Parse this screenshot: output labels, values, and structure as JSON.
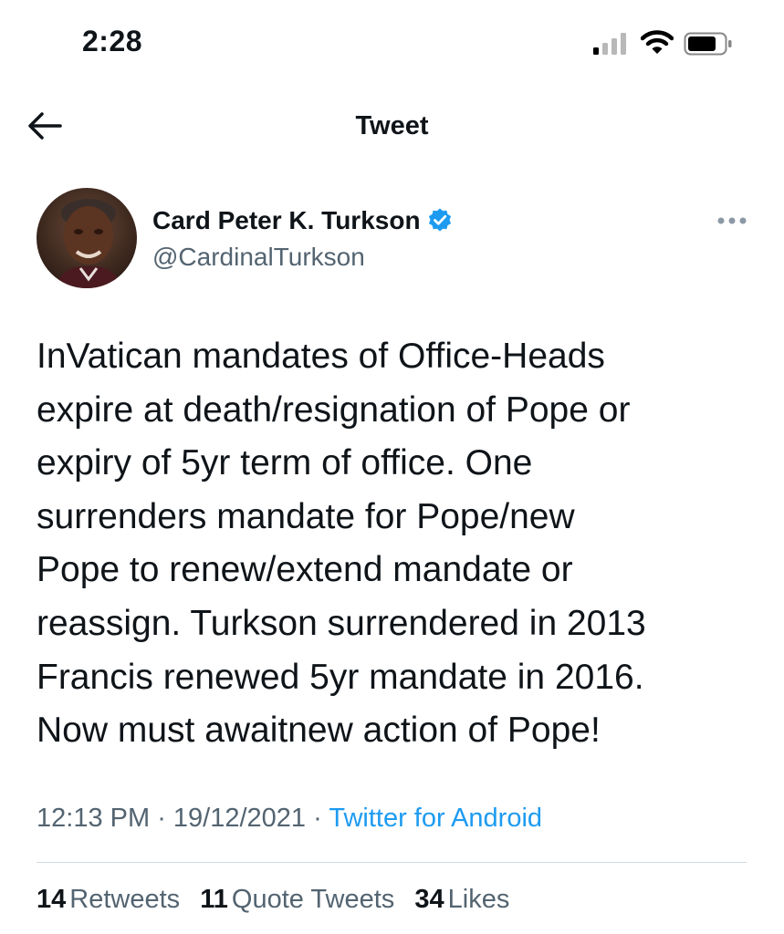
{
  "status_bar": {
    "time": "2:28",
    "signal_icon": "cellular-signal-icon",
    "wifi_icon": "wifi-icon",
    "battery_icon": "battery-icon"
  },
  "nav": {
    "title": "Tweet",
    "back_icon": "arrow-left-icon"
  },
  "author": {
    "name": "Card Peter K. Turkson",
    "handle": "@CardinalTurkson",
    "verified_icon": "verified-badge-icon",
    "more_icon": "more-options-icon"
  },
  "tweet": {
    "lines": [
      "InVatican mandates of Office-Heads",
      "expire at death/resignation of Pope or",
      "expiry of 5yr term of office. One",
      "surrenders mandate for Pope/new",
      "Pope to renew/extend mandate or",
      "reassign. Turkson surrendered in 2013",
      "Francis renewed 5yr mandate in 2016.",
      "Now must awaitnew action of Pope!"
    ]
  },
  "meta": {
    "time": "12:13 PM",
    "sep1": " · ",
    "date": "19/12/2021",
    "sep2": " · ",
    "source": "Twitter for Android"
  },
  "stats": {
    "retweets": {
      "count": "14",
      "label": "Retweets"
    },
    "quotes": {
      "count": "11",
      "label": "Quote Tweets"
    },
    "likes": {
      "count": "34",
      "label": "Likes"
    }
  },
  "colors": {
    "text": "#0f1419",
    "secondary": "#536471",
    "link": "#1d9bf0",
    "divider": "#cfd9de"
  }
}
